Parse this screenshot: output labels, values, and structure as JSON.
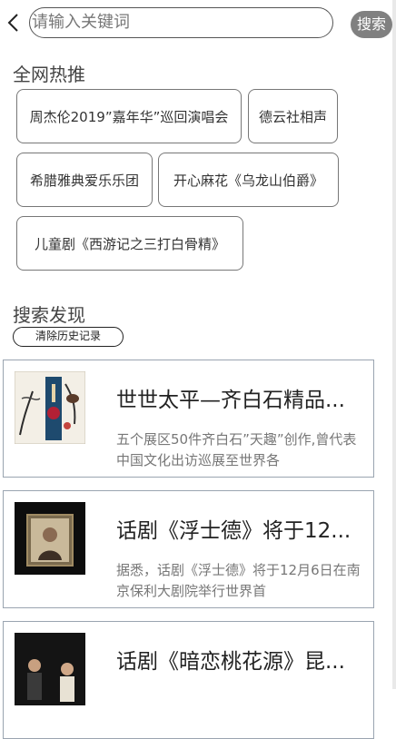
{
  "search": {
    "placeholder": "请输入关键词",
    "button_label": "搜索"
  },
  "hot": {
    "title": "全网热推",
    "tags": [
      "周杰伦2019”嘉年华”巡回演唱会",
      "德云社相声",
      "希腊雅典爱乐乐团",
      "开心麻花《乌龙山伯爵》",
      "儿童剧《西游记之三打白骨精》"
    ]
  },
  "discover": {
    "title": "搜索发现",
    "clear_label": "清除历史记录"
  },
  "results": [
    {
      "title": "世世太平—齐白石精品...",
      "desc": "五个展区50件齐白石”天趣”创作,曾代表中国文化出访巡展至世界各"
    },
    {
      "title": "话剧《浮士德》将于12...",
      "desc": "据悉，话剧《浮士德》将于12月6日在南京保利大剧院举行世界首"
    },
    {
      "title": "话剧《暗恋桃花源》昆...",
      "desc": ""
    }
  ]
}
